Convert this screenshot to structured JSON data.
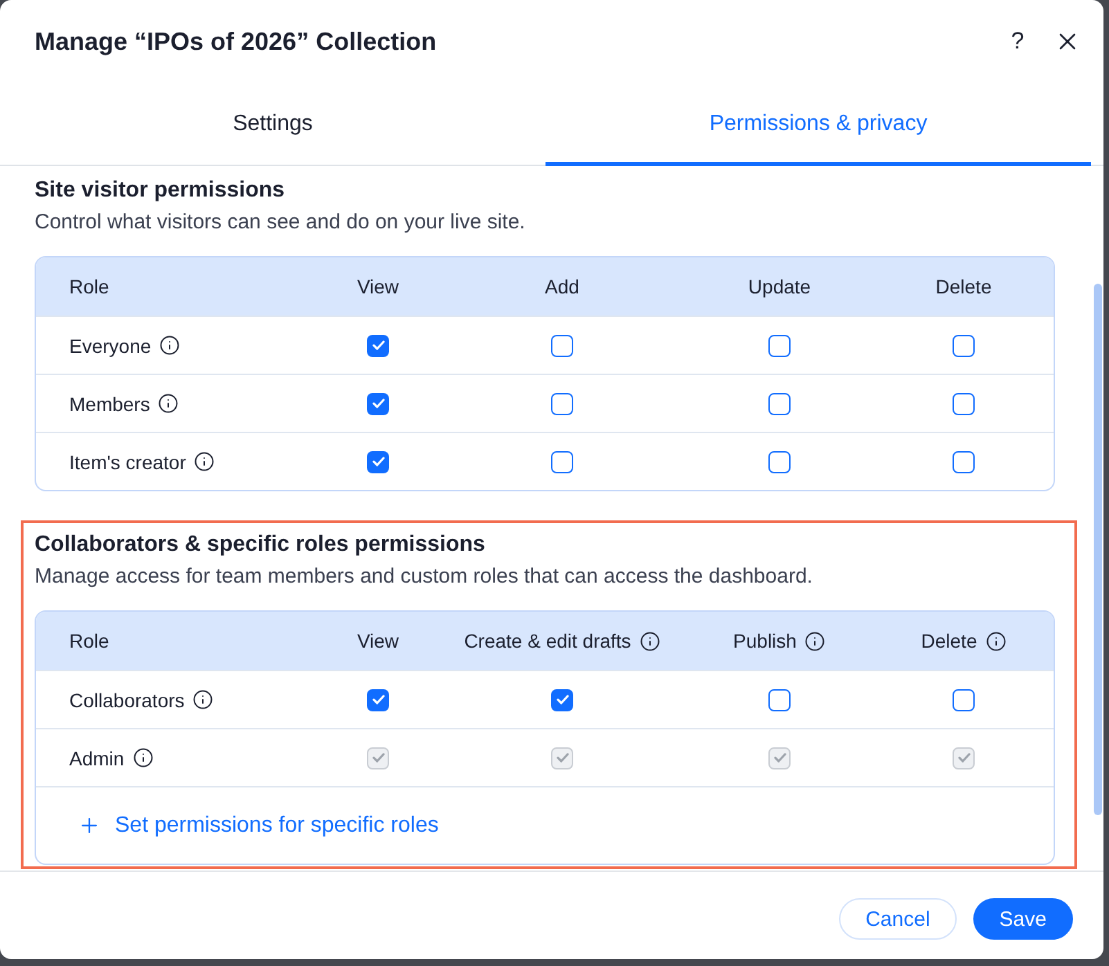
{
  "dialog": {
    "title": "Manage “IPOs of 2026” Collection",
    "help": "?"
  },
  "tabs": [
    {
      "label": "Settings",
      "selected": false
    },
    {
      "label": "Permissions & privacy",
      "selected": true
    }
  ],
  "sections": [
    {
      "title": "Site visitor permissions",
      "description": "Control what visitors can see and do on your live site.",
      "highlighted": false,
      "table": {
        "columns": [
          {
            "label": "Role",
            "info": false
          },
          {
            "label": "View",
            "info": false
          },
          {
            "label": "Add",
            "info": false
          },
          {
            "label": "Update",
            "info": false
          },
          {
            "label": "Delete",
            "info": false
          }
        ],
        "rows": [
          {
            "role": "Everyone",
            "info": true,
            "cells": [
              {
                "checked": true,
                "disabled": false
              },
              {
                "checked": false,
                "disabled": false
              },
              {
                "checked": false,
                "disabled": false
              },
              {
                "checked": false,
                "disabled": false
              }
            ]
          },
          {
            "role": "Members",
            "info": true,
            "cells": [
              {
                "checked": true,
                "disabled": false
              },
              {
                "checked": false,
                "disabled": false
              },
              {
                "checked": false,
                "disabled": false
              },
              {
                "checked": false,
                "disabled": false
              }
            ]
          },
          {
            "role": "Item's creator",
            "info": true,
            "cells": [
              {
                "checked": true,
                "disabled": false
              },
              {
                "checked": false,
                "disabled": false
              },
              {
                "checked": false,
                "disabled": false
              },
              {
                "checked": false,
                "disabled": false
              }
            ]
          }
        ]
      }
    },
    {
      "title": "Collaborators & specific roles permissions",
      "description": "Manage access for team members and custom roles that can access the dashboard.",
      "highlighted": true,
      "table": {
        "columns": [
          {
            "label": "Role",
            "info": false
          },
          {
            "label": "View",
            "info": false
          },
          {
            "label": "Create & edit drafts",
            "info": true
          },
          {
            "label": "Publish",
            "info": true
          },
          {
            "label": "Delete",
            "info": true
          }
        ],
        "rows": [
          {
            "role": "Collaborators",
            "info": true,
            "cells": [
              {
                "checked": true,
                "disabled": false
              },
              {
                "checked": true,
                "disabled": false
              },
              {
                "checked": false,
                "disabled": false
              },
              {
                "checked": false,
                "disabled": false
              }
            ]
          },
          {
            "role": "Admin",
            "info": true,
            "cells": [
              {
                "checked": true,
                "disabled": true
              },
              {
                "checked": true,
                "disabled": true
              },
              {
                "checked": true,
                "disabled": true
              },
              {
                "checked": true,
                "disabled": true
              }
            ]
          }
        ]
      },
      "add_link": "Set permissions for specific roles"
    }
  ],
  "footer": {
    "buttons": [
      {
        "label": "Cancel",
        "kind": "secondary"
      },
      {
        "label": "Save",
        "kind": "primary"
      }
    ]
  }
}
